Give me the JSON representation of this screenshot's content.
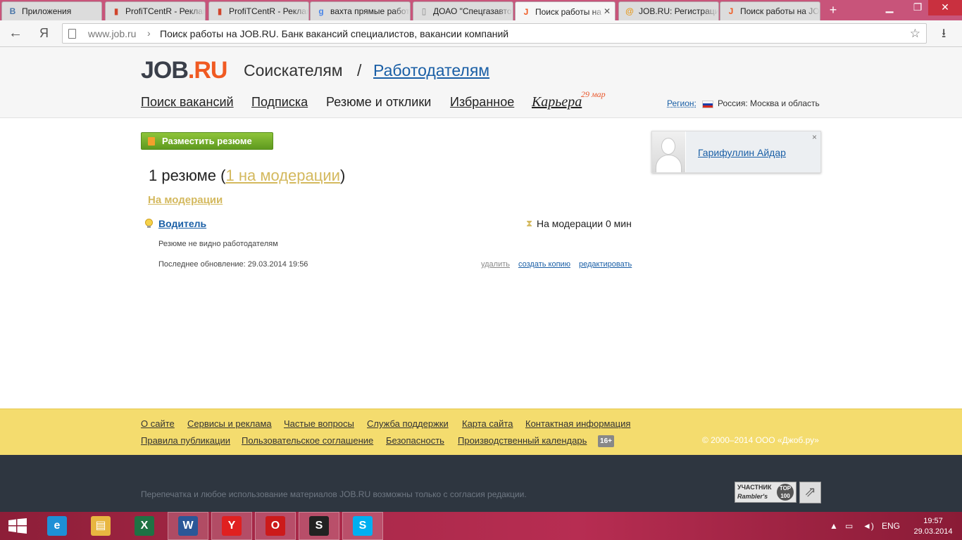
{
  "browser": {
    "tabs": [
      {
        "title": "Приложения",
        "favicon": "vk-icon",
        "fav_color": "#4a76a8",
        "fav_glyph": "В"
      },
      {
        "title": "ProfiTCentR - Рекламные",
        "favicon": "bar-chart-icon",
        "fav_color": "#d0452c",
        "fav_glyph": "▮"
      },
      {
        "title": "ProfiTCentR - Рекламные",
        "favicon": "bar-chart-icon",
        "fav_color": "#d0452c",
        "fav_glyph": "▮"
      },
      {
        "title": "вахта прямые работодатели",
        "favicon": "google-icon",
        "fav_color": "#4a86e8",
        "fav_glyph": "g"
      },
      {
        "title": "ДОАО \"Спецгазавтотранс\"",
        "favicon": "page-icon",
        "fav_color": "#888888",
        "fav_glyph": "▯"
      },
      {
        "title": "Поиск работы на JOB.RU",
        "favicon": "jobru-icon",
        "fav_color": "#f05a22",
        "fav_glyph": "J"
      },
      {
        "title": "JOB.RU: Регистрация",
        "favicon": "mail-icon",
        "fav_color": "#e79b1e",
        "fav_glyph": "@"
      },
      {
        "title": "Поиск работы на JOB.RU",
        "favicon": "jobru-icon",
        "fav_color": "#f05a22",
        "fav_glyph": "J"
      }
    ],
    "url_host": "www.job.ru",
    "url_sep": "›",
    "page_title": "Поиск работы на JOB.RU. Банк вакансий специалистов, вакансии компаний",
    "back_glyph": "←",
    "yandex_glyph": "Я"
  },
  "header": {
    "logo_job": "JOB",
    "logo_dot": ".",
    "logo_ru": "RU",
    "seekers": "Соискателям",
    "slash": "/",
    "employers": "Работодателям",
    "nav": [
      "Поиск вакансий",
      "Подписка",
      "Резюме и отклики",
      "Избранное"
    ],
    "career": "Карьера",
    "career_date": "29 мар",
    "region_label": "Регион:",
    "region_value": "Россия: Москва и область"
  },
  "main": {
    "post_button": "Разместить резюме",
    "count_prefix": "1 резюме (",
    "count_link": "1 на модерации",
    "count_suffix": ")",
    "section_title": "На модерации",
    "resume": {
      "title": "Водитель",
      "status": "На модерации 0 мин",
      "note": "Резюме не видно работодателям",
      "updated": "Последнее обновление: 29.03.2014 19:56",
      "actions": [
        "удалить",
        "создать копию",
        "редактировать"
      ]
    }
  },
  "user": {
    "name": "Гарифуллин Айдар",
    "close": "×"
  },
  "footer": {
    "links_row1": [
      "О сайте",
      "Сервисы и реклама",
      "Частые вопросы",
      "Служба поддержки",
      "Карта сайта",
      "Контактная информация"
    ],
    "links_row2": [
      "Правила публикации",
      "Пользовательское соглашение",
      "Безопасность",
      "Производственный календарь"
    ],
    "age": "16+",
    "copyright": "© 2000–2014 ООО «Джоб.ру»",
    "reprint": "Перепечатка и любое использование материалов JOB.RU возможны только с согласия редакции.",
    "rambler_line1": "УЧАСТНИК",
    "rambler_line2": "Rambler's",
    "rambler_top": "TOP 100"
  },
  "taskbar": {
    "apps": [
      {
        "name": "ie",
        "glyph": "e",
        "color": "#1e90d6"
      },
      {
        "name": "explorer",
        "glyph": "▤",
        "color": "#e8b640"
      },
      {
        "name": "excel",
        "glyph": "X",
        "color": "#1f7244"
      },
      {
        "name": "word",
        "glyph": "W",
        "color": "#2b5797"
      },
      {
        "name": "yandex",
        "glyph": "Y",
        "color": "#e02020"
      },
      {
        "name": "opera",
        "glyph": "O",
        "color": "#cc1a1a"
      },
      {
        "name": "steam",
        "glyph": "S",
        "color": "#222222"
      },
      {
        "name": "skype",
        "glyph": "S",
        "color": "#00aff0"
      }
    ],
    "lang": "ENG",
    "time": "19:57",
    "date": "29.03.2014"
  },
  "colors": {
    "link": "#1a5fa6",
    "moderation": "#d4b95e",
    "accent": "#f05a22",
    "button_green": "#6fae27",
    "footer_yellow": "#f4dc6e",
    "footer_dark": "#2e3640"
  }
}
